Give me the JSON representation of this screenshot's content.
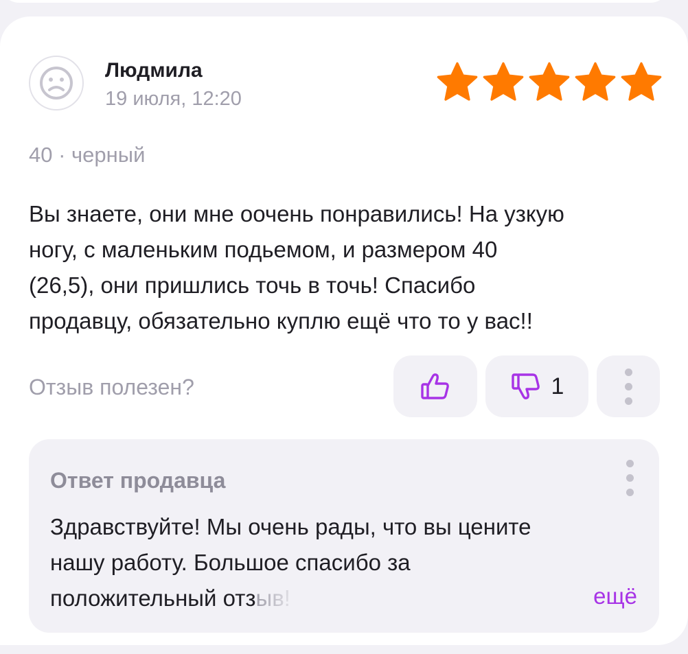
{
  "review": {
    "author": "Людмила",
    "date": "19 июля, 12:20",
    "rating": 5,
    "variant": "40 · черный",
    "text_lines": [
      "Вы знаете, они мне оочень понравились! На узкую",
      "ногу, с маленьким подьемом, и размером 40",
      "(26,5), они пришлись точь в точь! Спасибо",
      "продавцу, обязательно куплю ещё что то у вас!!"
    ]
  },
  "feedback": {
    "helpful_label": "Отзыв полезен?",
    "dislike_count": "1"
  },
  "seller_reply": {
    "title": "Ответ продавца",
    "line_1": "Здравствуйте! Мы очень рады, что вы цените",
    "line_2": "нашу работу. Большое спасибо за",
    "line_3_main": "положительный отз",
    "line_3_faded": "ыв!",
    "more_label": "ещё"
  },
  "icons": {
    "avatar": "sad-face-icon",
    "rating": "star-icon",
    "like": "thumbs-up-icon",
    "dislike": "thumbs-down-icon",
    "more": "vertical-dots-icon"
  },
  "colors": {
    "star": "#ff7a00",
    "accent": "#a733e6",
    "muted_text": "#a09eab",
    "button_bg": "#f2f1f6"
  }
}
